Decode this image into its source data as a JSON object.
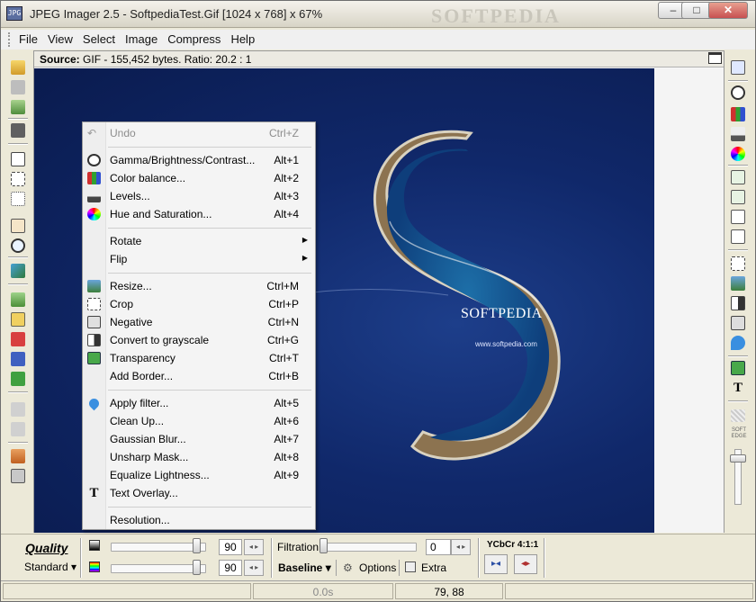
{
  "window": {
    "title": "JPEG Imager 2.5 - SoftpediaTest.Gif [1024 x 768] x 67%",
    "watermark": "SOFTPEDIA",
    "minimize": "–",
    "maximize": "□",
    "close": "✕"
  },
  "menu": [
    "File",
    "View",
    "Select",
    "Image",
    "Compress",
    "Help"
  ],
  "source": {
    "label": "Source:",
    "info": "GIF - 155,452 bytes. Ratio: 20.2 : 1"
  },
  "image": {
    "brand": "SOFTPEDIA",
    "url": "www.softpedia.com"
  },
  "context_menu": [
    {
      "label": "Undo",
      "shortcut": "Ctrl+Z",
      "icon": "undo-icon",
      "disabled": true
    },
    {
      "label": "Gamma/Brightness/Contrast...",
      "shortcut": "Alt+1",
      "icon": "brightness-icon"
    },
    {
      "label": "Color balance...",
      "shortcut": "Alt+2",
      "icon": "color-balance-icon"
    },
    {
      "label": "Levels...",
      "shortcut": "Alt+3",
      "icon": "levels-icon"
    },
    {
      "label": "Hue and Saturation...",
      "shortcut": "Alt+4",
      "icon": "hue-wheel-icon"
    },
    {
      "label": "Rotate",
      "submenu": true
    },
    {
      "label": "Flip",
      "submenu": true
    },
    {
      "label": "Resize...",
      "shortcut": "Ctrl+M",
      "icon": "resize-icon"
    },
    {
      "label": "Crop",
      "shortcut": "Ctrl+P",
      "icon": "crop-icon"
    },
    {
      "label": "Negative",
      "shortcut": "Ctrl+N",
      "icon": "negative-icon"
    },
    {
      "label": "Convert to grayscale",
      "shortcut": "Ctrl+G",
      "icon": "grayscale-icon"
    },
    {
      "label": "Transparency",
      "shortcut": "Ctrl+T",
      "icon": "transparency-icon"
    },
    {
      "label": "Add Border...",
      "shortcut": "Ctrl+B",
      "icon": "border-icon"
    },
    {
      "label": "Apply filter...",
      "shortcut": "Alt+5",
      "icon": "drop-icon"
    },
    {
      "label": "Clean Up...",
      "shortcut": "Alt+6"
    },
    {
      "label": "Gaussian Blur...",
      "shortcut": "Alt+7"
    },
    {
      "label": "Unsharp Mask...",
      "shortcut": "Alt+8"
    },
    {
      "label": "Equalize Lightness...",
      "shortcut": "Alt+9"
    },
    {
      "label": "Text Overlay...",
      "icon": "text-icon"
    },
    {
      "label": "Resolution..."
    }
  ],
  "bottom": {
    "quality_label": "Quality",
    "standard_label": "Standard ▾",
    "slider1_value": "90",
    "slider2_value": "90",
    "slider1_level": 0.95,
    "slider2_level": 0.95,
    "filtration_label": "Filtration",
    "filtration_value": "0",
    "baseline_label": "Baseline ▾",
    "options_label": "Options",
    "extra_label": "Extra",
    "ycbcr_label": "YCbCr 4:1:1",
    "spin_arrows": "◂ ▸"
  },
  "right_panel": {
    "soft_edge_label": "SOFT EDGE"
  },
  "status": {
    "time": "0.0s",
    "coords": "79, 88"
  },
  "colors": {
    "image_bg": "#10286a",
    "menu_bg": "#f4f4f4"
  }
}
